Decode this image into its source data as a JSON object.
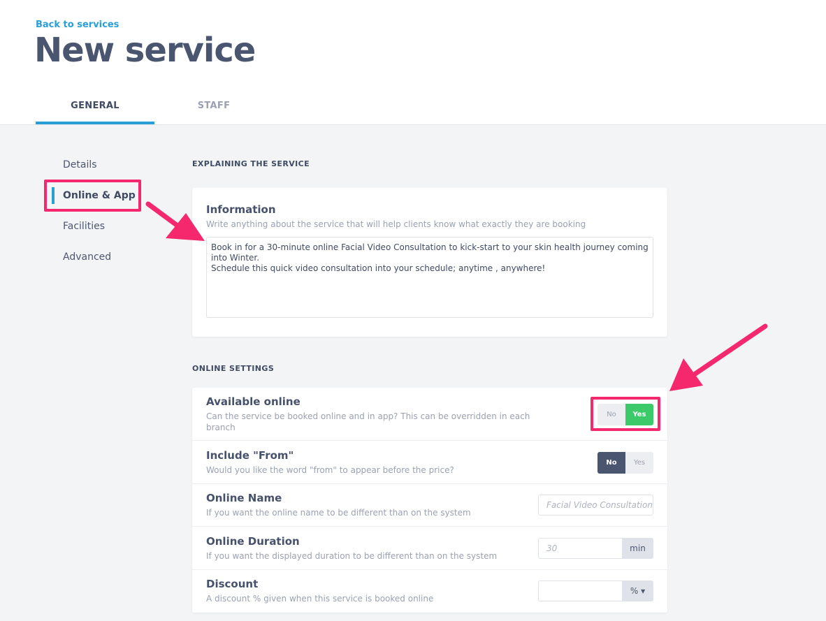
{
  "header": {
    "back_link": "Back to services",
    "title": "New service",
    "tabs": [
      {
        "label": "GENERAL",
        "active": true
      },
      {
        "label": "STAFF",
        "active": false
      }
    ]
  },
  "sidebar": {
    "items": [
      {
        "label": "Details",
        "active": false
      },
      {
        "label": "Online & App",
        "active": true
      },
      {
        "label": "Facilities",
        "active": false
      },
      {
        "label": "Advanced",
        "active": false
      }
    ]
  },
  "explaining": {
    "heading": "EXPLAINING THE SERVICE",
    "info_title": "Information",
    "info_desc": "Write anything about the service that will help clients know what exactly they are booking",
    "info_value": "Book in for a 30-minute online Facial Video Consultation to kick-start to your skin health journey coming into Winter.\nSchedule this quick video consultation into your schedule; anytime , anywhere!"
  },
  "online": {
    "heading": "ONLINE SETTINGS",
    "available": {
      "title": "Available online",
      "desc": "Can the service be booked online and in app? This can be overridden in each branch",
      "no_label": "No",
      "yes_label": "Yes",
      "selected": "Yes"
    },
    "include_from": {
      "title": "Include \"From\"",
      "desc": "Would you like the word \"from\" to appear before the price?",
      "no_label": "No",
      "yes_label": "Yes",
      "selected": "No"
    },
    "online_name": {
      "title": "Online Name",
      "desc": "If you want the online name to be different than on the system",
      "placeholder": "Facial Video Consultation"
    },
    "online_duration": {
      "title": "Online Duration",
      "desc": "If you want the displayed duration to be different than on the system",
      "placeholder": "30",
      "unit": "min"
    },
    "discount": {
      "title": "Discount",
      "desc": "A discount % given when this service is booked online",
      "value": "",
      "unit": "% ▾"
    }
  },
  "colors": {
    "accent": "#2a9fd6",
    "highlight": "#f5286e",
    "toggle_yes": "#3bc96a",
    "toggle_dark": "#4a5570"
  }
}
